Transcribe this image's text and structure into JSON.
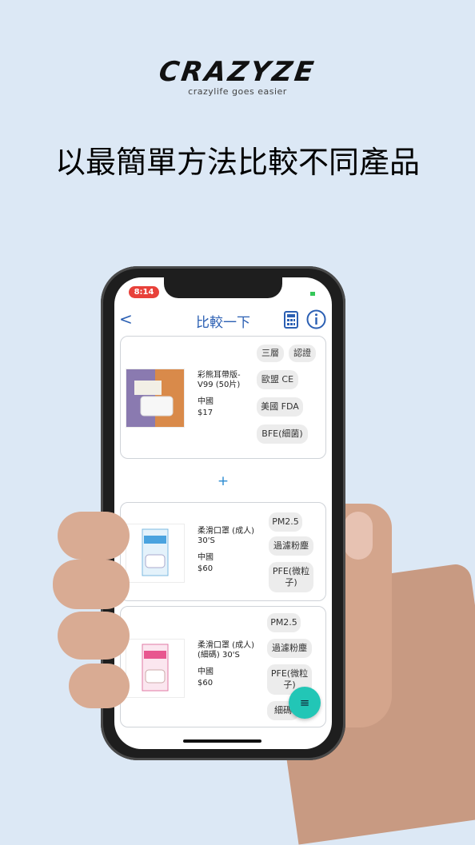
{
  "brand": {
    "name": "CRAZYZE",
    "tagline": "crazylife goes easier"
  },
  "headline": "以最簡單方法比較不同產品",
  "status": {
    "time": "8:14"
  },
  "nav": {
    "back": "<",
    "title": "比較一下"
  },
  "add_label": "+",
  "fab_label": "≡",
  "products": [
    {
      "name": "彩熊耳帶版-V99 (50片)",
      "country": "中國",
      "price": "$17",
      "tags": [
        "三層",
        "認證",
        "歐盟 CE",
        "美國 FDA",
        "BFE(細菌)"
      ]
    },
    {
      "name": "柔滑口罩 (成人) 30'S",
      "country": "中國",
      "price": "$60",
      "tags": [
        "PM2.5",
        "過濾粉塵",
        "PFE(微粒子)"
      ]
    },
    {
      "name": "柔滑口罩 (成人) (細碼) 30'S",
      "country": "中國",
      "price": "$60",
      "tags": [
        "PM2.5",
        "過濾粉塵",
        "PFE(微粒子)",
        "細碼"
      ]
    }
  ],
  "colors": {
    "accent": "#2b5fb3",
    "fab": "#22c6b6",
    "background": "#dce8f5"
  }
}
